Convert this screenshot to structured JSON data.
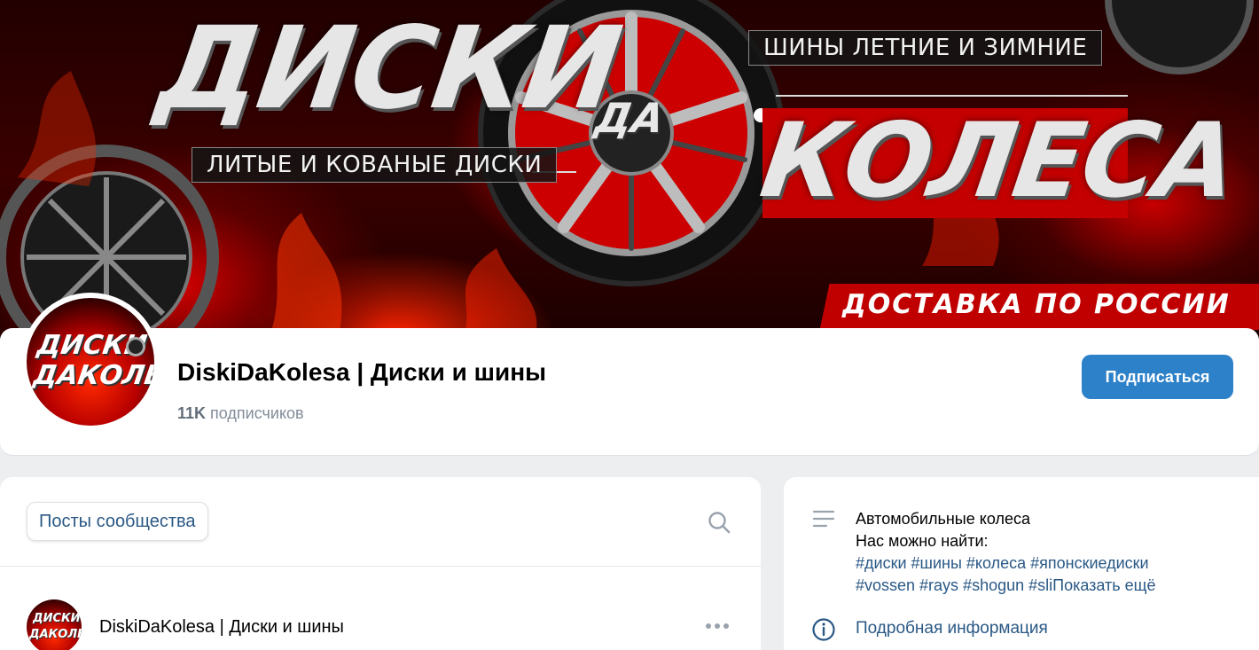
{
  "cover": {
    "headline_left": "ДИСКИ",
    "headline_right": "КОЛЕСА",
    "wheel_badge": "ДА",
    "pill_top": "ШИНЫ ЛЕТНИЕ И ЗИМНИЕ",
    "pill_left": "ЛИТЫЕ И КОВАНЫЕ ДИСКИ",
    "delivery": "ДОСТАВКА ПО РОССИИ"
  },
  "avatar": {
    "line1": "ДИСКИ",
    "line2": "ДАКОЛЕСА"
  },
  "header": {
    "title": "DiskiDaKolesa | Диски и шины",
    "subscribers_count": "11K",
    "subscribers_label": "подписчиков",
    "subscribe_button": "Подписаться"
  },
  "posts": {
    "tab_label": "Посты сообщества",
    "first_post": {
      "author": "DiskiDaKolesa | Диски и шины",
      "avatar_line1": "ДИСКИ",
      "avatar_line2": "ДАКОЛЕСА"
    }
  },
  "info": {
    "description_line1": "Автомобильные колеса",
    "description_line2": "Нас можно найти:",
    "tags_line1": "#диски #шины #колеса #японскиедиски",
    "tags_line2": "#vossen #rays #shogun #sli",
    "show_more": "Показать ещё",
    "details_link": "Подробная информация"
  },
  "colors": {
    "accent": "#2d81c8",
    "link": "#2a5885",
    "muted": "#818c99",
    "background": "#edeef0"
  }
}
